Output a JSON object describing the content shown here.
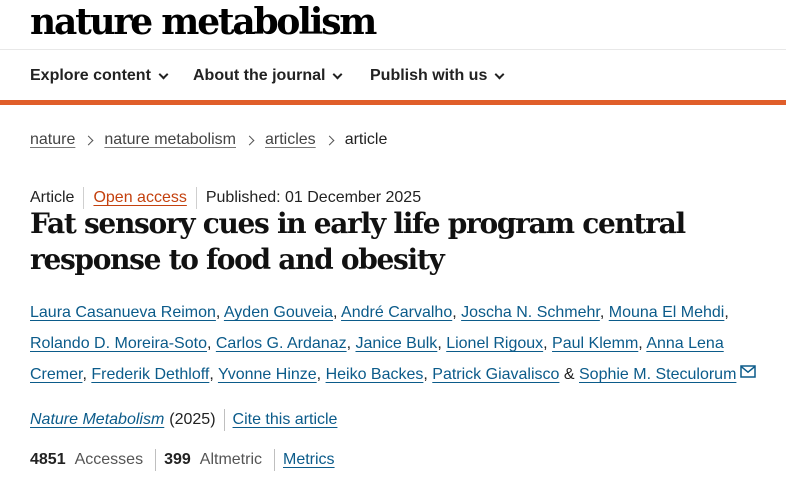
{
  "header": {
    "logo": "nature metabolism"
  },
  "nav": {
    "items": [
      {
        "label": "Explore content"
      },
      {
        "label": "About the journal"
      },
      {
        "label": "Publish with us"
      }
    ]
  },
  "breadcrumb": {
    "items": [
      "nature",
      "nature metabolism",
      "articles"
    ],
    "current": "article"
  },
  "article": {
    "type": "Article",
    "access": "Open access",
    "published": "Published: 01 December 2025",
    "title": "Fat sensory cues in early life program central response to food and obesity",
    "authors": [
      "Laura Casanueva Reimon",
      "Ayden Gouveia",
      "André Carvalho",
      "Joscha N. Schmehr",
      "Mouna El Mehdi",
      "Rolando D. Moreira-Soto",
      "Carlos G. Ardanaz",
      "Janice Bulk",
      "Lionel Rigoux",
      "Paul Klemm",
      "Anna Lena Cremer",
      "Frederik Dethloff",
      "Yvonne Hinze",
      "Heiko Backes",
      "Patrick Giavalisco",
      "Sophie M. Steculorum"
    ],
    "author_separator": ", ",
    "last_author_separator": " & ",
    "contact_icon": "envelope-icon",
    "journal": "Nature Metabolism",
    "year": "(2025)",
    "cite_label": "Cite this article"
  },
  "metrics": {
    "accesses_value": "4851",
    "accesses_label": "Accesses",
    "altmetric_value": "399",
    "altmetric_label": "Altmetric",
    "metrics_link": "Metrics"
  },
  "colors": {
    "accent": "#e05e2a",
    "link": "#0b5b8a",
    "open_access": "#c4410e"
  }
}
